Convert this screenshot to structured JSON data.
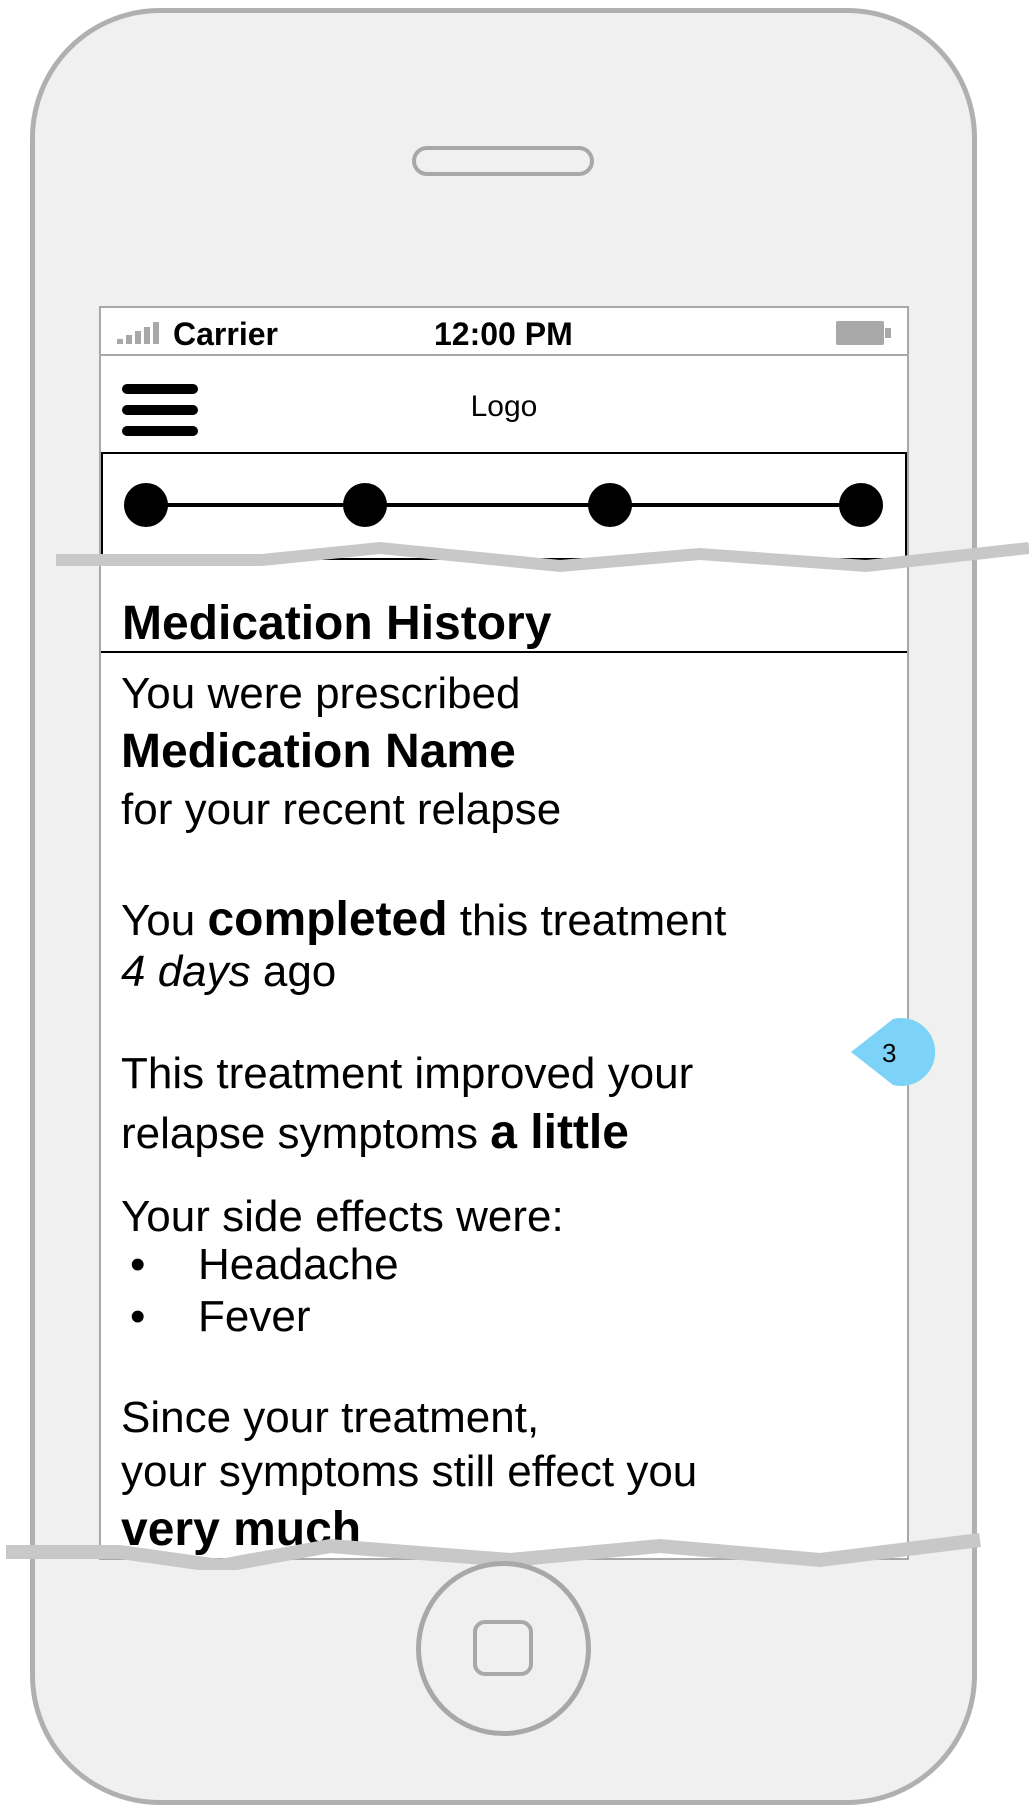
{
  "status_bar": {
    "carrier": "Carrier",
    "time": "12:00 PM"
  },
  "header": {
    "logo": "Logo"
  },
  "progress": {
    "steps": 4
  },
  "main": {
    "title": "Medication History",
    "prescribed_intro": "You were prescribed",
    "medication_name": "Medication Name",
    "prescribed_reason": "for your recent relapse",
    "completed_prefix": "You ",
    "completed_status": "completed",
    "completed_suffix": " this treatment",
    "completed_duration": "4 days",
    "completed_ago": " ago",
    "improvement_line1": "This treatment improved your",
    "improvement_prefix": "relapse symptoms ",
    "improvement_level": "a little",
    "side_effects_heading": "Your side effects were:",
    "side_effects": [
      "Headache",
      "Fever"
    ],
    "bullet_char": "•",
    "since_line1": "Since your treatment,",
    "since_line2": "your symptoms still effect you",
    "since_level": "very much"
  },
  "annotation": {
    "number": "3",
    "color": "#7dd3f7"
  },
  "colors": {
    "frame": "#b0b0b0",
    "phone_body": "#f0f0f0",
    "tear": "#c8c8c8"
  }
}
